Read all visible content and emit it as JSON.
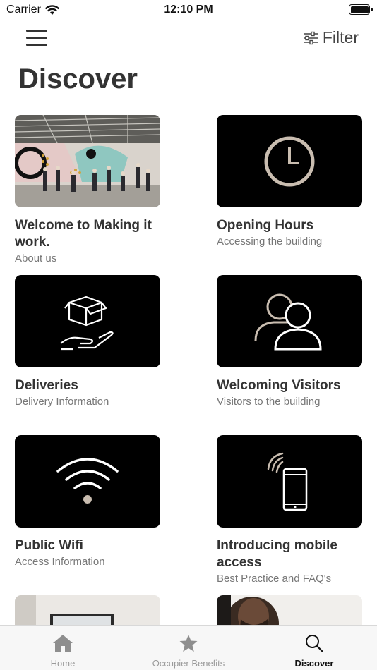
{
  "status_bar": {
    "carrier": "Carrier",
    "time": "12:10 PM"
  },
  "nav": {
    "filter_label": "Filter"
  },
  "page": {
    "title": "Discover"
  },
  "cards": [
    {
      "title": "Welcome to Making it work.",
      "subtitle": "About us",
      "icon": "photo-office"
    },
    {
      "title": "Opening Hours",
      "subtitle": "Accessing the building",
      "icon": "clock-icon"
    },
    {
      "title": "Deliveries",
      "subtitle": "Delivery Information",
      "icon": "package-hand-icon"
    },
    {
      "title": "Welcoming Visitors",
      "subtitle": "Visitors to the building",
      "icon": "people-icon"
    },
    {
      "title": "Public Wifi",
      "subtitle": "Access Information",
      "icon": "wifi-icon"
    },
    {
      "title": "Introducing mobile access",
      "subtitle": "Best Practice and FAQ's",
      "icon": "phone-signal-icon"
    }
  ],
  "tab_bar": {
    "tabs": [
      {
        "label": "Home",
        "icon": "home-icon",
        "active": false
      },
      {
        "label": "Occupier Benefits",
        "icon": "star-icon",
        "active": false
      },
      {
        "label": "Discover",
        "icon": "search-icon",
        "active": true
      }
    ]
  },
  "colors": {
    "icon_stroke": "#c9bdb0",
    "card_bg": "#000000",
    "title_text": "#333333"
  }
}
